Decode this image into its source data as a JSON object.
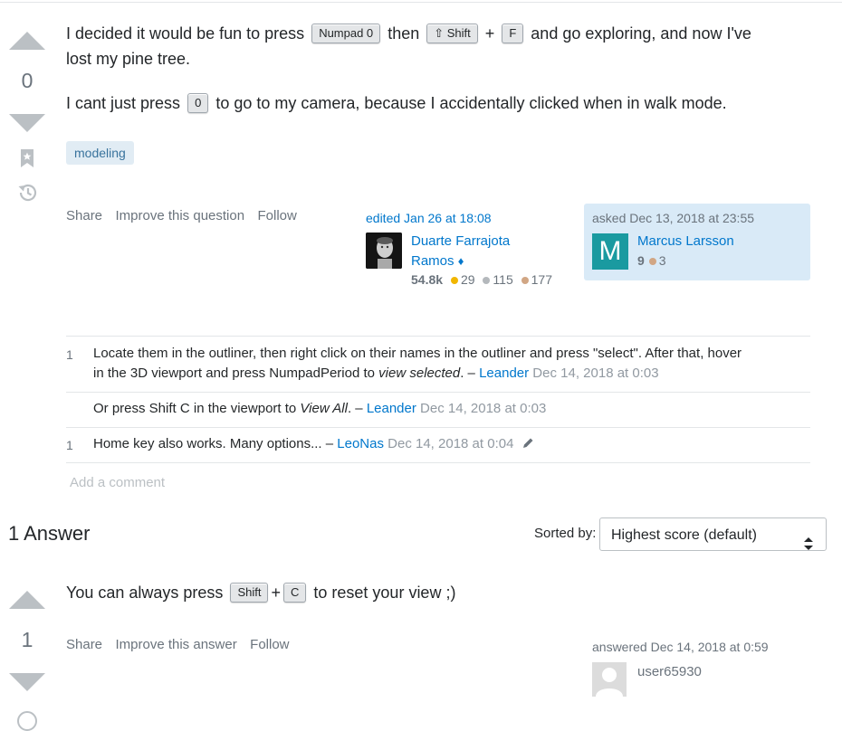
{
  "question": {
    "score": "0",
    "p1": {
      "t1": "I decided it would be fun to press",
      "k1": "Numpad 0",
      "t2": "then",
      "k2": "⇧ Shift",
      "t3": "+",
      "k3": "F",
      "t4": "and go exploring, and now I've",
      "t5": "lost my pine tree."
    },
    "p2": {
      "t1": "I cant just press",
      "k1": "0",
      "t2": "to go to my camera, because I accidentally clicked when in walk mode."
    },
    "tags": [
      "modeling"
    ],
    "menu": {
      "share": "Share",
      "improve": "Improve this question",
      "follow": "Follow"
    },
    "edited": {
      "label": "edited Jan 26 at 18:08",
      "user_line1": "Duarte Farrajota",
      "user_line2": "Ramos",
      "rep": "54.8k",
      "gold": "29",
      "silver": "115",
      "bronze": "177"
    },
    "asked": {
      "label": "asked Dec 13, 2018 at 23:55",
      "user": "Marcus Larsson",
      "avatar_letter": "M",
      "rep": "9",
      "bronze": "3"
    }
  },
  "comments": [
    {
      "score": "1",
      "line1": "Locate them in the outliner, then right click on their names in the outliner and press \"select\". After that, hover",
      "line2a": "in the 3D viewport and press NumpadPeriod to ",
      "line2i": "view selected",
      "line2b": ". – ",
      "user": "Leander",
      "date": " Dec 14, 2018 at 0:03"
    },
    {
      "score": "",
      "a": "Or press Shift C in the viewport to ",
      "i": "View All",
      "b": ". – ",
      "user": "Leander",
      "date": " Dec 14, 2018 at 0:03"
    },
    {
      "score": "1",
      "a": "Home key also works. Many options... – ",
      "user": "LeoNas",
      "date": " Dec 14, 2018 at 0:04"
    }
  ],
  "add_comment": "Add a comment",
  "answers_header": {
    "count": "1 Answer",
    "sorted_by": "Sorted by:",
    "sort_value": "Highest score (default)"
  },
  "answer": {
    "score": "1",
    "t1": "You can always press",
    "k1": "Shift",
    "t2": "+",
    "k2": "C",
    "t3": "to reset your view ;)",
    "menu": {
      "share": "Share",
      "improve": "Improve this answer",
      "follow": "Follow"
    },
    "answered": "answered Dec 14, 2018 at 0:59",
    "user": "user65930"
  },
  "colors": {
    "link": "#0077cc",
    "tag_bg": "#e1ecf4",
    "owner_bg": "#d9eaf7",
    "avatar_m": "#1a9aa0"
  }
}
